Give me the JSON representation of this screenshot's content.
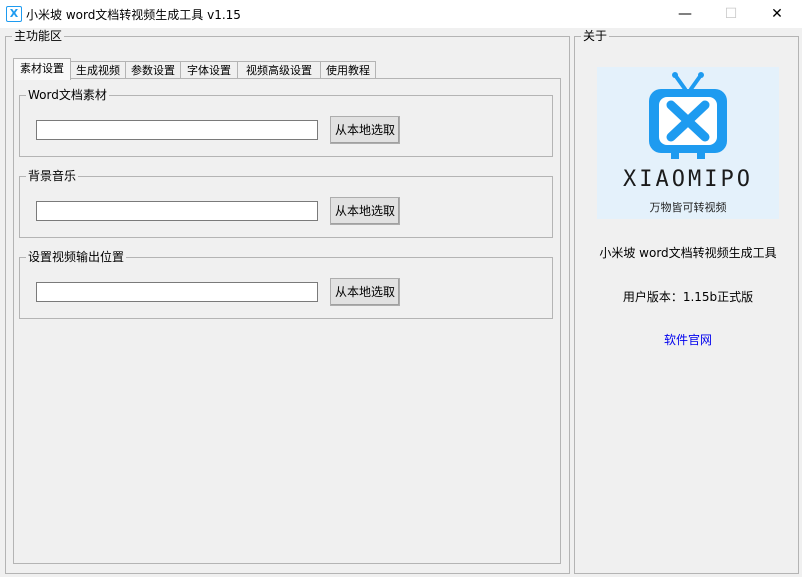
{
  "window": {
    "title": "小米坡 word文档转视频生成工具 v1.15",
    "app_icon_glyph": "X",
    "minimize_symbol": "—",
    "maximize_symbol": "☐",
    "close_symbol": "✕"
  },
  "main_panel": {
    "group_title": "主功能区",
    "tabs": [
      {
        "label": "素材设置",
        "active": true
      },
      {
        "label": "生成视频",
        "active": false
      },
      {
        "label": "参数设置",
        "active": false
      },
      {
        "label": "字体设置",
        "active": false
      },
      {
        "label": "视频高级设置",
        "active": false
      },
      {
        "label": "使用教程",
        "active": false
      }
    ],
    "sections": [
      {
        "title": "Word文档素材",
        "input_value": "",
        "button_label": "从本地选取"
      },
      {
        "title": "背景音乐",
        "input_value": "",
        "button_label": "从本地选取"
      },
      {
        "title": "设置视频输出位置",
        "input_value": "",
        "button_label": "从本地选取"
      }
    ]
  },
  "about_panel": {
    "group_title": "关于",
    "logo": {
      "brand": "XIAOMIPO",
      "slogan": "万物皆可转视频",
      "icon": "tv-x-logo-icon",
      "color": "#1e9bf0"
    },
    "product_text": "小米坡 word文档转视频生成工具",
    "version_text": "用户版本：1.15b正式版",
    "website_link": "软件官网"
  }
}
